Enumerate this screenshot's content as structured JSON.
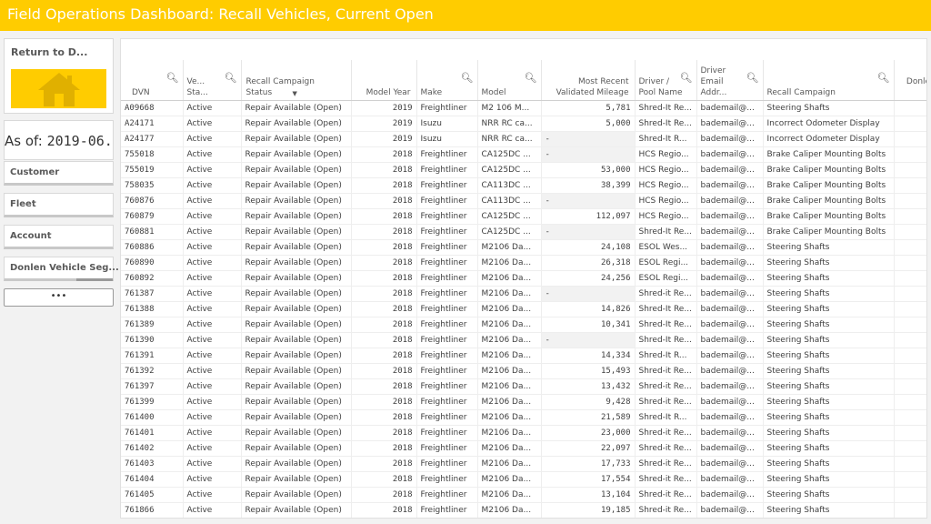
{
  "header": {
    "title": "Field Operations Dashboard: Recall Vehicles, Current Open"
  },
  "sidebar": {
    "return_label": "Return to D...",
    "home_icon": "home-icon",
    "as_of_prefix": "As of: ",
    "as_of_date": "2019-06...",
    "filters": [
      "Customer",
      "Fleet",
      "Account",
      "Donlen Vehicle Seg..."
    ],
    "more_label": "•••"
  },
  "table": {
    "columns": [
      "DVN",
      "Ve... Sta...",
      "Recall Campaign Status",
      "Model Year",
      "Make",
      "Model",
      "Most Recent Validated Mileage",
      "Driver / Pool Name",
      "Driver Email Addr...",
      "Recall Campaign",
      "Donlen Recall ID"
    ],
    "rows": [
      [
        "A09668",
        "Active",
        "Repair Available (Open)",
        "2019",
        "Freightliner",
        "M2 106 M...",
        "5,781",
        "Shred-It Re...",
        "bademail@...",
        "Steering Shafts",
        ""
      ],
      [
        "A24171",
        "Active",
        "Repair Available (Open)",
        "2019",
        "Isuzu",
        "NRR RC ca...",
        "5,000",
        "Shred-It Re...",
        "bademail@...",
        "Incorrect Odometer Display",
        ""
      ],
      [
        "A24177",
        "Active",
        "Repair Available (Open)",
        "2019",
        "Isuzu",
        "NRR RC ca...",
        "-",
        "Shred-It R...",
        "bademail@...",
        "Incorrect Odometer Display",
        ""
      ],
      [
        "755018",
        "Active",
        "Repair Available (Open)",
        "2018",
        "Freightliner",
        "CA125DC ...",
        "-",
        "HCS Regio...",
        "bademail@...",
        "Brake Caliper Mounting Bolts",
        ""
      ],
      [
        "755019",
        "Active",
        "Repair Available (Open)",
        "2018",
        "Freightliner",
        "CA125DC ...",
        "53,000",
        "HCS Regio...",
        "bademail@...",
        "Brake Caliper Mounting Bolts",
        ""
      ],
      [
        "758035",
        "Active",
        "Repair Available (Open)",
        "2018",
        "Freightliner",
        "CA113DC ...",
        "38,399",
        "HCS Regio...",
        "bademail@...",
        "Brake Caliper Mounting Bolts",
        ""
      ],
      [
        "760876",
        "Active",
        "Repair Available (Open)",
        "2018",
        "Freightliner",
        "CA113DC ...",
        "-",
        "HCS Regio...",
        "bademail@...",
        "Brake Caliper Mounting Bolts",
        ""
      ],
      [
        "760879",
        "Active",
        "Repair Available (Open)",
        "2018",
        "Freightliner",
        "CA125DC ...",
        "112,097",
        "HCS Regio...",
        "bademail@...",
        "Brake Caliper Mounting Bolts",
        ""
      ],
      [
        "760881",
        "Active",
        "Repair Available (Open)",
        "2018",
        "Freightliner",
        "CA125DC ...",
        "-",
        "Shred-It Re...",
        "bademail@...",
        "Brake Caliper Mounting Bolts",
        ""
      ],
      [
        "760886",
        "Active",
        "Repair Available (Open)",
        "2018",
        "Freightliner",
        "M2106 Da...",
        "24,108",
        "ESOL Wes...",
        "bademail@...",
        "Steering Shafts",
        ""
      ],
      [
        "760890",
        "Active",
        "Repair Available (Open)",
        "2018",
        "Freightliner",
        "M2106 Da...",
        "26,318",
        "ESOL Regi...",
        "bademail@...",
        "Steering Shafts",
        ""
      ],
      [
        "760892",
        "Active",
        "Repair Available (Open)",
        "2018",
        "Freightliner",
        "M2106 Da...",
        "24,256",
        "ESOL Regi...",
        "bademail@...",
        "Steering Shafts",
        ""
      ],
      [
        "761387",
        "Active",
        "Repair Available (Open)",
        "2018",
        "Freightliner",
        "M2106 Da...",
        "-",
        "Shred-it Re...",
        "bademail@...",
        "Steering Shafts",
        ""
      ],
      [
        "761388",
        "Active",
        "Repair Available (Open)",
        "2018",
        "Freightliner",
        "M2106 Da...",
        "14,826",
        "Shred-It Re...",
        "bademail@...",
        "Steering Shafts",
        ""
      ],
      [
        "761389",
        "Active",
        "Repair Available (Open)",
        "2018",
        "Freightliner",
        "M2106 Da...",
        "10,341",
        "Shred-It Re...",
        "bademail@...",
        "Steering Shafts",
        ""
      ],
      [
        "761390",
        "Active",
        "Repair Available (Open)",
        "2018",
        "Freightliner",
        "M2106 Da...",
        "-",
        "Shred-It Re...",
        "bademail@...",
        "Steering Shafts",
        ""
      ],
      [
        "761391",
        "Active",
        "Repair Available (Open)",
        "2018",
        "Freightliner",
        "M2106 Da...",
        "14,334",
        "Shred-It R...",
        "bademail@...",
        "Steering Shafts",
        ""
      ],
      [
        "761392",
        "Active",
        "Repair Available (Open)",
        "2018",
        "Freightliner",
        "M2106 Da...",
        "15,493",
        "Shred-it Re...",
        "bademail@...",
        "Steering Shafts",
        ""
      ],
      [
        "761397",
        "Active",
        "Repair Available (Open)",
        "2018",
        "Freightliner",
        "M2106 Da...",
        "13,432",
        "Shred-it Re...",
        "bademail@...",
        "Steering Shafts",
        ""
      ],
      [
        "761399",
        "Active",
        "Repair Available (Open)",
        "2018",
        "Freightliner",
        "M2106 Da...",
        "9,428",
        "Shred-it Re...",
        "bademail@...",
        "Steering Shafts",
        ""
      ],
      [
        "761400",
        "Active",
        "Repair Available (Open)",
        "2018",
        "Freightliner",
        "M2106 Da...",
        "21,589",
        "Shred-It R...",
        "bademail@...",
        "Steering Shafts",
        ""
      ],
      [
        "761401",
        "Active",
        "Repair Available (Open)",
        "2018",
        "Freightliner",
        "M2106 Da...",
        "23,000",
        "Shred-it Re...",
        "bademail@...",
        "Steering Shafts",
        ""
      ],
      [
        "761402",
        "Active",
        "Repair Available (Open)",
        "2018",
        "Freightliner",
        "M2106 Da...",
        "22,097",
        "Shred-it Re...",
        "bademail@...",
        "Steering Shafts",
        ""
      ],
      [
        "761403",
        "Active",
        "Repair Available (Open)",
        "2018",
        "Freightliner",
        "M2106 Da...",
        "17,733",
        "Shred-it Re...",
        "bademail@...",
        "Steering Shafts",
        ""
      ],
      [
        "761404",
        "Active",
        "Repair Available (Open)",
        "2018",
        "Freightliner",
        "M2106 Da...",
        "17,554",
        "Shred-it Re...",
        "bademail@...",
        "Steering Shafts",
        ""
      ],
      [
        "761405",
        "Active",
        "Repair Available (Open)",
        "2018",
        "Freightliner",
        "M2106 Da...",
        "13,104",
        "Shred-it Re...",
        "bademail@...",
        "Steering Shafts",
        ""
      ],
      [
        "761866",
        "Active",
        "Repair Available (Open)",
        "2018",
        "Freightliner",
        "M2106 Da...",
        "19,185",
        "Shred-it Re...",
        "bademail@...",
        "Steering Shafts",
        ""
      ]
    ]
  },
  "colors": {
    "brand": "#ffcc00"
  }
}
